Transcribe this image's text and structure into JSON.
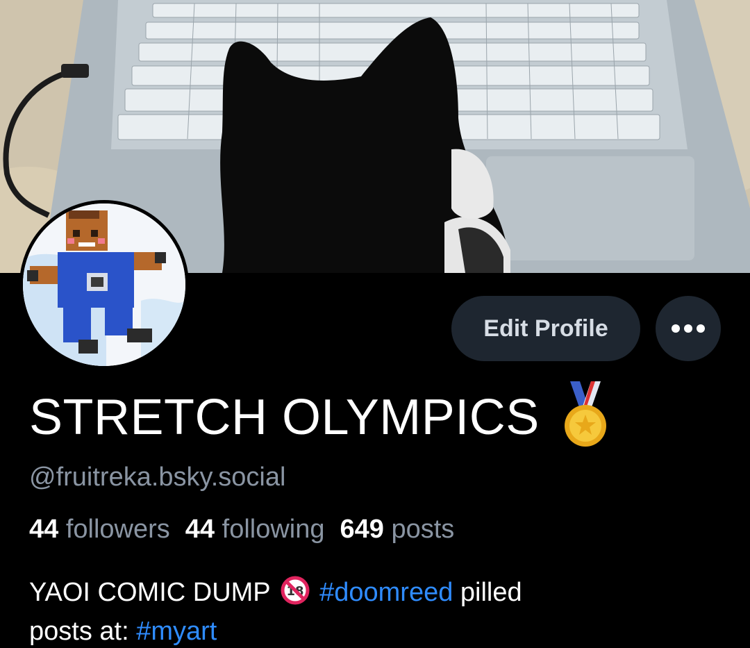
{
  "profile": {
    "display_name": "STRETCH OLYMPICS",
    "badge_icon": "sports-medal-icon",
    "handle": "@fruitreka.bsky.social",
    "stats": [
      {
        "count": "44",
        "label": "followers"
      },
      {
        "count": "44",
        "label": "following"
      },
      {
        "count": "649",
        "label": "posts"
      }
    ],
    "bio": {
      "part1": "YAOI COMIC DUMP",
      "age_icon": "no-one-under-eighteen-icon",
      "tag1": "#doomreed",
      "part2": "pilled",
      "part3": "posts at:",
      "tag2": "#myart"
    }
  },
  "actions": {
    "edit_label": "Edit Profile",
    "more_icon": "more-options-icon"
  },
  "colors": {
    "background": "#000000",
    "button_bg": "#1e2630",
    "muted_text": "#8a95a3",
    "link": "#2f8cff"
  }
}
